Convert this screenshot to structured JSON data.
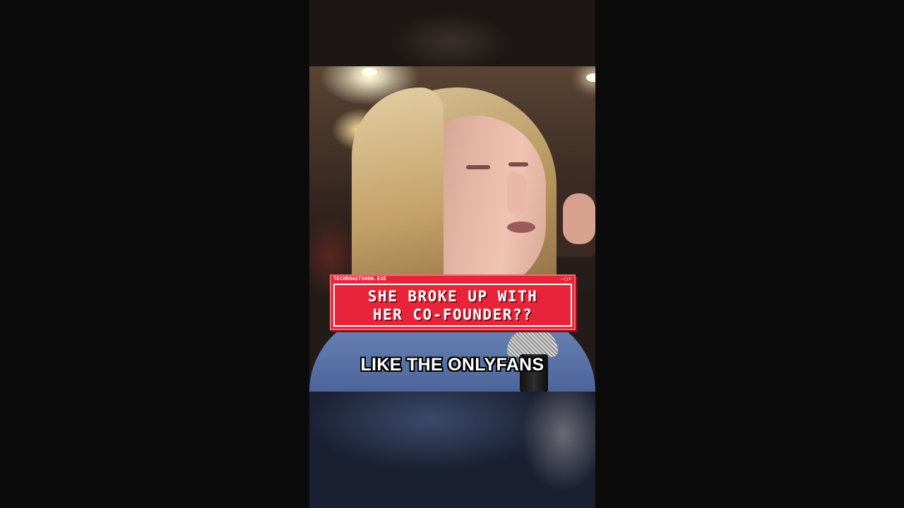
{
  "video": {
    "overlay_window": {
      "title": "TECHROASTSHOW.EXE",
      "controls": "–□×",
      "headline_lines": [
        "SHE BROKE UP WITH",
        "HER CO-FOUNDER??"
      ]
    },
    "caption": "LIKE THE ONLYFANS"
  },
  "colors": {
    "overlay_red": "#e8243a",
    "caption_text": "#ffffff",
    "letterbox": "#0b0b0b"
  }
}
